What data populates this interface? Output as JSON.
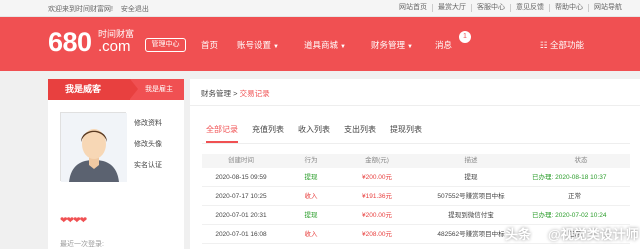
{
  "topbar": {
    "welcome": "欢迎来到时间财富网!",
    "logout": "安全退出",
    "links": [
      "网站首页",
      "最赏大厅",
      "客服中心",
      "意见反馈",
      "帮助中心",
      "网站导航"
    ]
  },
  "nav": {
    "logo_num": "680",
    "logo_sub": "时间财富",
    "logo_com": ".com",
    "mgmt_label": "管理中心",
    "items": [
      "首页",
      "账号设置",
      "道具商城",
      "财务管理",
      "消息"
    ],
    "message_count": "1",
    "all_functions": "全部功能"
  },
  "sidebar": {
    "tab_me": "我是威客",
    "tab_owner": "我是雇主",
    "links": [
      "修改资料",
      "修改头像",
      "实名认证"
    ],
    "hearts": "❤❤❤❤",
    "last_login": "最近一次登录:"
  },
  "content": {
    "breadcrumb_root": "财务管理",
    "breadcrumb_sep": ">",
    "breadcrumb_current": "交易记录",
    "tabs": [
      "全部记录",
      "充值列表",
      "收入列表",
      "支出列表",
      "提现列表"
    ],
    "table": {
      "headers": [
        "创建时间",
        "行为",
        "金额(元)",
        "描述",
        "状态"
      ],
      "rows": [
        {
          "time": "2020-08-15 09:59",
          "action": "提现",
          "amount": "¥200.00元",
          "desc": "提现",
          "status": "已办理: 2020-08-18 10:37",
          "action_color": "green",
          "amount_color": "red",
          "status_color": "green"
        },
        {
          "time": "2020-07-17 10:25",
          "action": "收入",
          "amount": "¥191.36元",
          "desc": "507552号赚赏项目中标",
          "status": "正常",
          "action_color": "red",
          "amount_color": "red",
          "status_color": "default"
        },
        {
          "time": "2020-07-01 20:31",
          "action": "提现",
          "amount": "¥200.00元",
          "desc": "提现到微信付宝",
          "status": "已办理: 2020-07-02 10:24",
          "action_color": "green",
          "amount_color": "red",
          "status_color": "green"
        },
        {
          "time": "2020-07-01 16:08",
          "action": "收入",
          "amount": "¥208.00元",
          "desc": "482562号赚赏项目中标",
          "status": "正常",
          "action_color": "red",
          "amount_color": "red",
          "status_color": "default"
        }
      ]
    }
  },
  "watermark": {
    "prefix": "头条",
    "handle": "@视觉类设计师"
  },
  "colors": {
    "brand": "#f05052",
    "green": "#2a9d2a",
    "red": "#e8403f"
  }
}
